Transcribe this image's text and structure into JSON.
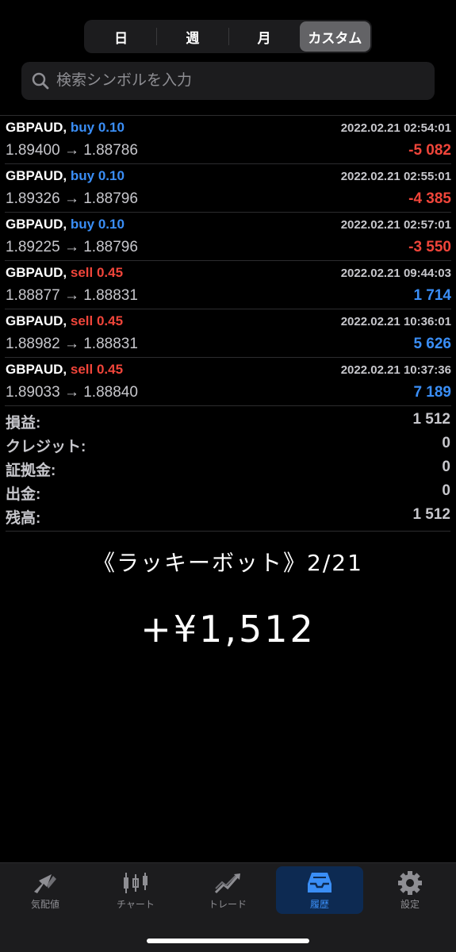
{
  "segment": {
    "items": [
      "日",
      "週",
      "月",
      "カスタム"
    ],
    "active": "カスタム"
  },
  "search": {
    "placeholder": "検索シンボルを入力"
  },
  "trades": [
    {
      "symbol": "GBPAUD,",
      "side": "buy",
      "volume": "0.10",
      "side_label": "buy 0.10",
      "time": "2022.02.21 02:54:01",
      "prices": "1.89400 → 1.88786",
      "profit": "-5 082",
      "sign": "neg"
    },
    {
      "symbol": "GBPAUD,",
      "side": "buy",
      "volume": "0.10",
      "side_label": "buy 0.10",
      "time": "2022.02.21 02:55:01",
      "prices": "1.89326 → 1.88796",
      "profit": "-4 385",
      "sign": "neg"
    },
    {
      "symbol": "GBPAUD,",
      "side": "buy",
      "volume": "0.10",
      "side_label": "buy 0.10",
      "time": "2022.02.21 02:57:01",
      "prices": "1.89225 → 1.88796",
      "profit": "-3 550",
      "sign": "neg"
    },
    {
      "symbol": "GBPAUD,",
      "side": "sell",
      "volume": "0.45",
      "side_label": "sell 0.45",
      "time": "2022.02.21 09:44:03",
      "prices": "1.88877 → 1.88831",
      "profit": "1 714",
      "sign": "pos"
    },
    {
      "symbol": "GBPAUD,",
      "side": "sell",
      "volume": "0.45",
      "side_label": "sell 0.45",
      "time": "2022.02.21 10:36:01",
      "prices": "1.88982 → 1.88831",
      "profit": "5 626",
      "sign": "pos"
    },
    {
      "symbol": "GBPAUD,",
      "side": "sell",
      "volume": "0.45",
      "side_label": "sell 0.45",
      "time": "2022.02.21 10:37:36",
      "prices": "1.89033 → 1.88840",
      "profit": "7 189",
      "sign": "pos"
    }
  ],
  "summary": [
    {
      "label": "損益:",
      "value": "1 512"
    },
    {
      "label": "クレジット:",
      "value": "0"
    },
    {
      "label": "証拠金:",
      "value": "0"
    },
    {
      "label": "出金:",
      "value": "0"
    },
    {
      "label": "残高:",
      "value": "1 512"
    }
  ],
  "overlay": {
    "caption": "《ラッキーボット》2/21",
    "amount": "+¥1,512"
  },
  "tabbar": {
    "items": [
      {
        "label": "気配値",
        "icon": "quotes-icon"
      },
      {
        "label": "チャート",
        "icon": "chart-icon"
      },
      {
        "label": "トレード",
        "icon": "trade-icon"
      },
      {
        "label": "履歴",
        "icon": "history-icon"
      },
      {
        "label": "設定",
        "icon": "settings-icon"
      }
    ],
    "active": "履歴"
  },
  "colors": {
    "buy": "#3a8ef6",
    "sell": "#f0453a",
    "positive": "#3a8ef6",
    "negative": "#f0453a",
    "active_tab": "#3a8ef6"
  }
}
